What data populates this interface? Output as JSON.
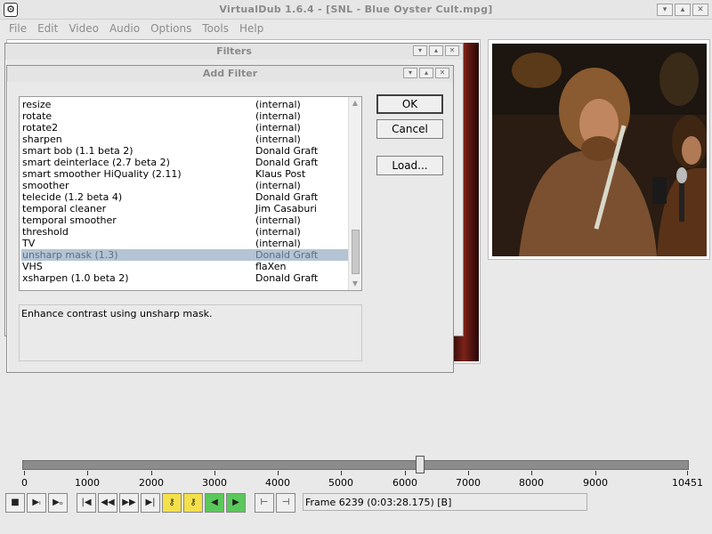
{
  "app": {
    "title": "VirtualDub 1.6.4 - [SNL - Blue Oyster Cult.mpg]",
    "menu": [
      "File",
      "Edit",
      "Video",
      "Audio",
      "Options",
      "Tools",
      "Help"
    ]
  },
  "filters_dialog": {
    "title": "Filters"
  },
  "add_filter_dialog": {
    "title": "Add Filter",
    "rows": [
      {
        "name": "resize",
        "author": "(internal)"
      },
      {
        "name": "rotate",
        "author": "(internal)"
      },
      {
        "name": "rotate2",
        "author": "(internal)"
      },
      {
        "name": "sharpen",
        "author": "(internal)"
      },
      {
        "name": "smart bob (1.1 beta 2)",
        "author": "Donald Graft"
      },
      {
        "name": "smart deinterlace (2.7 beta 2)",
        "author": "Donald Graft"
      },
      {
        "name": "smart smoother HiQuality (2.11)",
        "author": "Klaus Post"
      },
      {
        "name": "smoother",
        "author": "(internal)"
      },
      {
        "name": "telecide (1.2 beta 4)",
        "author": "Donald Graft"
      },
      {
        "name": "temporal cleaner",
        "author": "Jim Casaburi"
      },
      {
        "name": "temporal smoother",
        "author": "(internal)"
      },
      {
        "name": "threshold",
        "author": "(internal)"
      },
      {
        "name": "TV",
        "author": "(internal)"
      },
      {
        "name": "unsharp mask (1.3)",
        "author": "Donald Graft"
      },
      {
        "name": "VHS",
        "author": "flaXen"
      },
      {
        "name": "xsharpen (1.0 beta 2)",
        "author": "Donald Graft"
      }
    ],
    "selected_index": 13,
    "description": "Enhance contrast using unsharp mask.",
    "buttons": {
      "ok": "OK",
      "cancel": "Cancel",
      "load": "Load..."
    }
  },
  "timeline": {
    "ticks": [
      "0",
      "1000",
      "2000",
      "3000",
      "4000",
      "5000",
      "6000",
      "7000",
      "8000",
      "9000",
      "10451"
    ],
    "tick_values": [
      0,
      1000,
      2000,
      3000,
      4000,
      5000,
      6000,
      7000,
      8000,
      9000,
      10451
    ],
    "max": 10451,
    "current_frame": 6239
  },
  "status": {
    "frame_text": "Frame 6239 (0:03:28.175) [B]"
  },
  "toolbar": {
    "icons": [
      "stop-icon",
      "play-input-icon",
      "play-output-icon",
      "start-icon",
      "prev-frame-icon",
      "next-frame-icon",
      "end-icon",
      "prev-key-icon",
      "next-key-icon",
      "prev-scene-icon",
      "next-scene-icon",
      "mark-in-icon",
      "mark-out-icon"
    ]
  },
  "colors": {
    "selection": "#b4c4d4",
    "disabled_text": "#8a8a8a"
  }
}
